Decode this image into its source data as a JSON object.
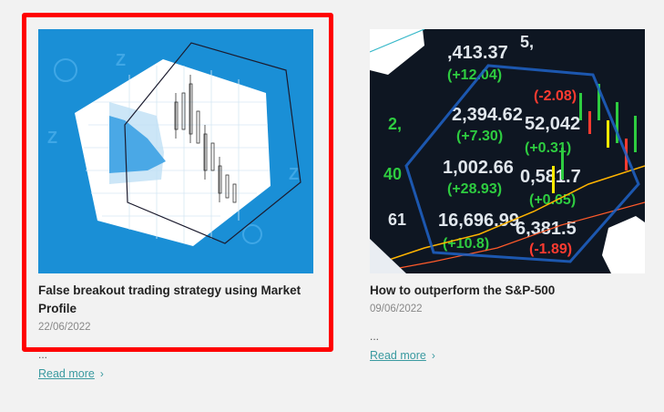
{
  "articles": [
    {
      "title": "False breakout trading strategy using Market Profile",
      "date": "22/06/2022",
      "ellipsis": "...",
      "read_more": "Read more",
      "chevron": "›"
    },
    {
      "title": "How to outperform the S&P-500",
      "date": "09/06/2022",
      "ellipsis": "...",
      "read_more": "Read more",
      "chevron": "›"
    }
  ],
  "colors": {
    "accent": "#3a9aa0",
    "highlight": "#ff0000",
    "thumb1_bg": "#1a8fd6"
  }
}
